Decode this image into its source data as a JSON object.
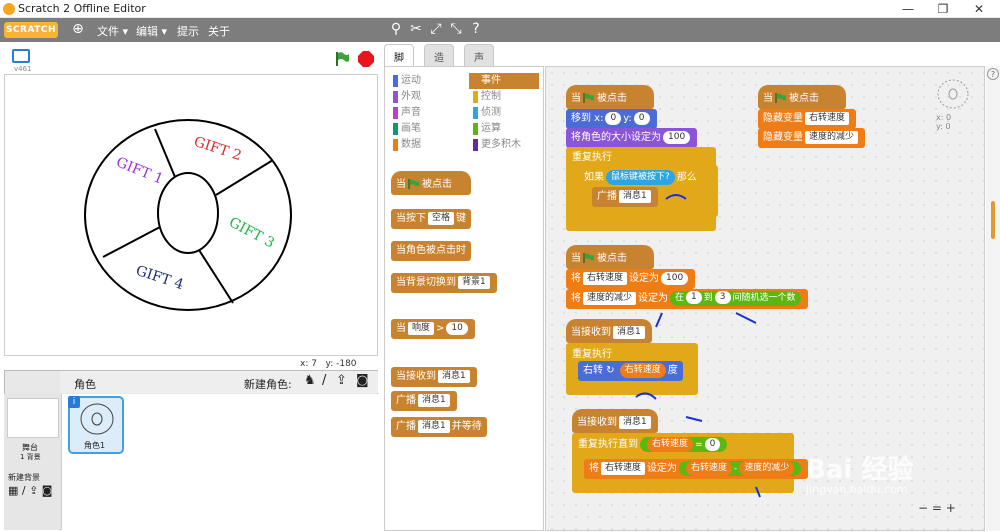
{
  "window": {
    "title": "Scratch 2 Offline Editor",
    "minimize": "—",
    "maximize": "❐",
    "close": "✕"
  },
  "menu": {
    "logo": "SCRATCH",
    "items": [
      "文件 ▾",
      "编辑 ▾",
      "提示",
      "关于"
    ]
  },
  "stage": {
    "version": "v461",
    "x_label": "x: 7",
    "y_label": "y: -180",
    "wheel_labels": [
      "GIFT 1",
      "GIFT 2",
      "GIFT 3",
      "GIFT 4"
    ],
    "wheel_colors": [
      "#9b30d9",
      "#e02828",
      "#1fb34a",
      "#1c2a7a"
    ]
  },
  "sprites": {
    "header": "角色",
    "new_sprite": "新建角色:",
    "stage_label": "舞台",
    "stage_sub": "1 背景",
    "new_backdrop": "新建背景",
    "sprite_name": "角色1"
  },
  "tabs": [
    "脚本",
    "造型",
    "声音"
  ],
  "palette": {
    "categories_left": [
      "运动",
      "外观",
      "声音",
      "画笔",
      "数据"
    ],
    "categories_right": [
      "事件",
      "控制",
      "侦测",
      "运算",
      "更多积木"
    ],
    "colors_left": [
      "#4a6cd4",
      "#8a55d7",
      "#bb42c3",
      "#0e9a6c",
      "#ee7d16"
    ],
    "colors_right": [
      "#c88330",
      "#e1a91a",
      "#2ca5e2",
      "#5cb712",
      "#632d99"
    ],
    "blocks": {
      "when_flag": "当",
      "when_flag_tail": "被点击",
      "key_press": "当按下",
      "key_value": "空格",
      "key_tail": "键",
      "sprite_click": "当角色被点击时",
      "backdrop_switch": "当背景切换到",
      "backdrop_value": "背景1",
      "when_gt": "当",
      "loudness": "响度",
      "gt": ">",
      "gt_value": "10",
      "receive": "当接收到",
      "msg": "消息1",
      "broadcast": "广播",
      "broadcast_wait_tail": "并等待"
    }
  },
  "script": {
    "s1": {
      "hat": "当",
      "hat_tail": "被点击",
      "move": "移到 x:",
      "x": "0",
      "y_label": "y:",
      "y": "0",
      "size": "将角色的大小设定为",
      "size_val": "100",
      "forever": "重复执行",
      "if": "如果",
      "cond": "鼠标键被按下?",
      "then": "那么",
      "broadcast": "广播",
      "msg": "消息1"
    },
    "s2": {
      "hat": "当",
      "hat_tail": "被点击",
      "hide1": "隐藏变量",
      "var1": "右转速度",
      "hide2": "隐藏变量",
      "var2": "速度的减少"
    },
    "s3": {
      "hat": "当",
      "hat_tail": "被点击",
      "set1": "将",
      "var1": "右转速度",
      "to1": "设定为",
      "val1": "100",
      "set2": "将",
      "var2": "速度的减少",
      "to2": "设定为",
      "rand": "在",
      "r1": "1",
      "r_to": "到",
      "r2": "3",
      "r_tail": "间随机选一个数"
    },
    "s4": {
      "hat": "当接收到",
      "msg": "消息1",
      "forever": "重复执行",
      "turn": "右转",
      "speed": "右转速度",
      "deg": "度"
    },
    "s5": {
      "hat": "当接收到",
      "msg": "消息1",
      "until": "重复执行直到",
      "speed": "右转速度",
      "eq": "=",
      "zero": "0",
      "set": "将",
      "var": "右转速度",
      "to": "设定为",
      "speed2": "右转速度",
      "minus": "-",
      "rest": "速度的减少"
    },
    "coords": {
      "x": "x: 0",
      "y": "y: 0"
    }
  },
  "zoom": {
    "out": "−",
    "reset": "=",
    "in": "+"
  },
  "watermark": "Bai 经验",
  "watermark_url": "jingyan.baidu.com"
}
